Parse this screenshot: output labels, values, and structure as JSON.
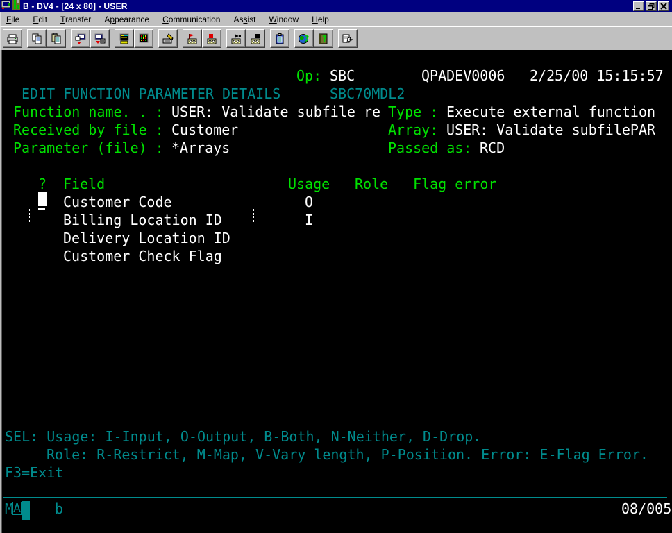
{
  "window": {
    "title": "B - DV4 - [24 x 80] - USER",
    "controls": [
      {
        "name": "minimize-button",
        "glyph": "minimize-icon"
      },
      {
        "name": "restore-button",
        "glyph": "restore-icon"
      },
      {
        "name": "close-button",
        "glyph": "close-icon"
      }
    ]
  },
  "menu": {
    "items": [
      {
        "label": "File",
        "pre": "",
        "mn": "F",
        "post": "ile"
      },
      {
        "label": "Edit",
        "pre": "",
        "mn": "E",
        "post": "dit"
      },
      {
        "label": "Transfer",
        "pre": "",
        "mn": "T",
        "post": "ransfer"
      },
      {
        "label": "Appearance",
        "pre": "A",
        "mn": "p",
        "post": "pearance"
      },
      {
        "label": "Communication",
        "pre": "",
        "mn": "C",
        "post": "ommunication"
      },
      {
        "label": "Assist",
        "pre": "As",
        "mn": "s",
        "post": "ist"
      },
      {
        "label": "Window",
        "pre": "",
        "mn": "W",
        "post": "indow"
      },
      {
        "label": "Help",
        "pre": "",
        "mn": "H",
        "post": "elp"
      }
    ]
  },
  "toolbar": {
    "groups": [
      [
        "print-icon"
      ],
      [
        "copy-icon",
        "paste-icon"
      ],
      [
        "send-file-icon",
        "receive-file-icon"
      ],
      [
        "display-setup-icon",
        "color-map-icon"
      ],
      [
        "keyboard-setup-icon"
      ],
      [
        "record-start-icon",
        "record-stop-icon"
      ],
      [
        "play-macro-icon",
        "stop-macro-icon"
      ],
      [
        "clipboard-icon"
      ],
      [
        "web-help-icon",
        "info-book-icon"
      ],
      [
        "hotspots-icon"
      ]
    ]
  },
  "terminal": {
    "colors": {
      "green": "#00e100",
      "teal": "#008b8d",
      "white": "#ffffff",
      "bg": "#000000",
      "titlebar": "#000080",
      "chrome": "#c0c0c0"
    },
    "lines": [
      {
        "row": 1,
        "segments": [
          {
            "col": 36,
            "color": "green",
            "text": "Op:"
          },
          {
            "col": 40,
            "color": "white",
            "text": "SBC"
          },
          {
            "col": 51,
            "color": "white",
            "text": "QPADEV0006"
          },
          {
            "col": 64,
            "color": "white",
            "text": "2/25/00 15:15:57"
          }
        ]
      },
      {
        "row": 2,
        "segments": [
          {
            "col": 3,
            "color": "teal",
            "text": "EDIT FUNCTION PARAMETER DETAILS",
            "name": "screen-title"
          },
          {
            "col": 40,
            "color": "teal",
            "text": "SBC70MDL2",
            "name": "screen-id"
          }
        ]
      },
      {
        "row": 3,
        "segments": [
          {
            "col": 2,
            "color": "green",
            "text": "Function name. . :"
          },
          {
            "col": 21,
            "color": "white",
            "text": "USER: Validate subfile re",
            "name": "function-name-value",
            "input": true
          },
          {
            "col": 47,
            "color": "green",
            "text": "Type :"
          },
          {
            "col": 54,
            "color": "white",
            "text": "Execute external function",
            "name": "function-type-value"
          }
        ]
      },
      {
        "row": 4,
        "segments": [
          {
            "col": 2,
            "color": "green",
            "text": "Received by file :"
          },
          {
            "col": 21,
            "color": "white",
            "text": "Customer",
            "name": "received-by-file-value",
            "input": true
          },
          {
            "col": 47,
            "color": "green",
            "text": "Array:"
          },
          {
            "col": 54,
            "color": "white",
            "text": "USER: Validate subfilePAR",
            "name": "array-value"
          }
        ]
      },
      {
        "row": 5,
        "segments": [
          {
            "col": 2,
            "color": "green",
            "text": "Parameter (file) :"
          },
          {
            "col": 21,
            "color": "white",
            "text": "*Arrays",
            "name": "parameter-file-value",
            "input": true
          },
          {
            "col": 47,
            "color": "green",
            "text": "Passed as:"
          },
          {
            "col": 58,
            "color": "white",
            "text": "RCD",
            "name": "passed-as-value"
          }
        ]
      },
      {
        "row": 7,
        "segments": [
          {
            "col": 5,
            "color": "green",
            "text": "?",
            "name": "column-header-sel"
          },
          {
            "col": 8,
            "color": "green",
            "text": "Field",
            "name": "column-header-field"
          },
          {
            "col": 35,
            "color": "green",
            "text": "Usage",
            "name": "column-header-usage"
          },
          {
            "col": 43,
            "color": "green",
            "text": "Role",
            "name": "column-header-role"
          },
          {
            "col": 50,
            "color": "green",
            "text": "Flag error",
            "name": "column-header-flag-error"
          }
        ]
      },
      {
        "row": 8,
        "segments": [
          {
            "col": 8,
            "color": "white",
            "text": "Customer Code",
            "name": "field-name"
          },
          {
            "col": 37,
            "color": "white",
            "text": "O",
            "name": "field-usage"
          }
        ]
      },
      {
        "row": 9,
        "segments": [
          {
            "col": 5,
            "color": "white",
            "text": "_",
            "name": "sel-input",
            "input": true
          },
          {
            "col": 8,
            "color": "white",
            "text": "Billing Location ID",
            "name": "field-name"
          },
          {
            "col": 37,
            "color": "white",
            "text": "I",
            "name": "field-usage"
          }
        ]
      },
      {
        "row": 10,
        "segments": [
          {
            "col": 5,
            "color": "white",
            "text": "_",
            "name": "sel-input",
            "input": true
          },
          {
            "col": 8,
            "color": "white",
            "text": "Delivery Location ID",
            "name": "field-name"
          }
        ]
      },
      {
        "row": 11,
        "segments": [
          {
            "col": 5,
            "color": "white",
            "text": "_",
            "name": "sel-input",
            "input": true
          },
          {
            "col": 8,
            "color": "white",
            "text": "Customer Check Flag",
            "name": "field-name"
          }
        ]
      },
      {
        "row": 21,
        "segments": [
          {
            "col": 1,
            "color": "teal",
            "text": "SEL: Usage: I-Input, O-Output, B-Both, N-Neither, D-Drop.",
            "name": "legend-usage"
          }
        ]
      },
      {
        "row": 22,
        "segments": [
          {
            "col": 6,
            "color": "teal",
            "text": "Role: R-Restrict, M-Map, V-Vary length, P-Position. Error: E-Flag Error.",
            "name": "legend-role"
          }
        ]
      },
      {
        "row": 23,
        "segments": [
          {
            "col": 1,
            "color": "teal",
            "text": "F3=Exit",
            "name": "function-key-hint"
          }
        ]
      }
    ],
    "cursor": {
      "row": 8,
      "col": 5
    },
    "selection": {
      "row": 9,
      "field": "Billing Location ID"
    },
    "oia": {
      "system": "M",
      "attn": "A",
      "keyboard": "b",
      "cursor_position": "08/005"
    }
  }
}
